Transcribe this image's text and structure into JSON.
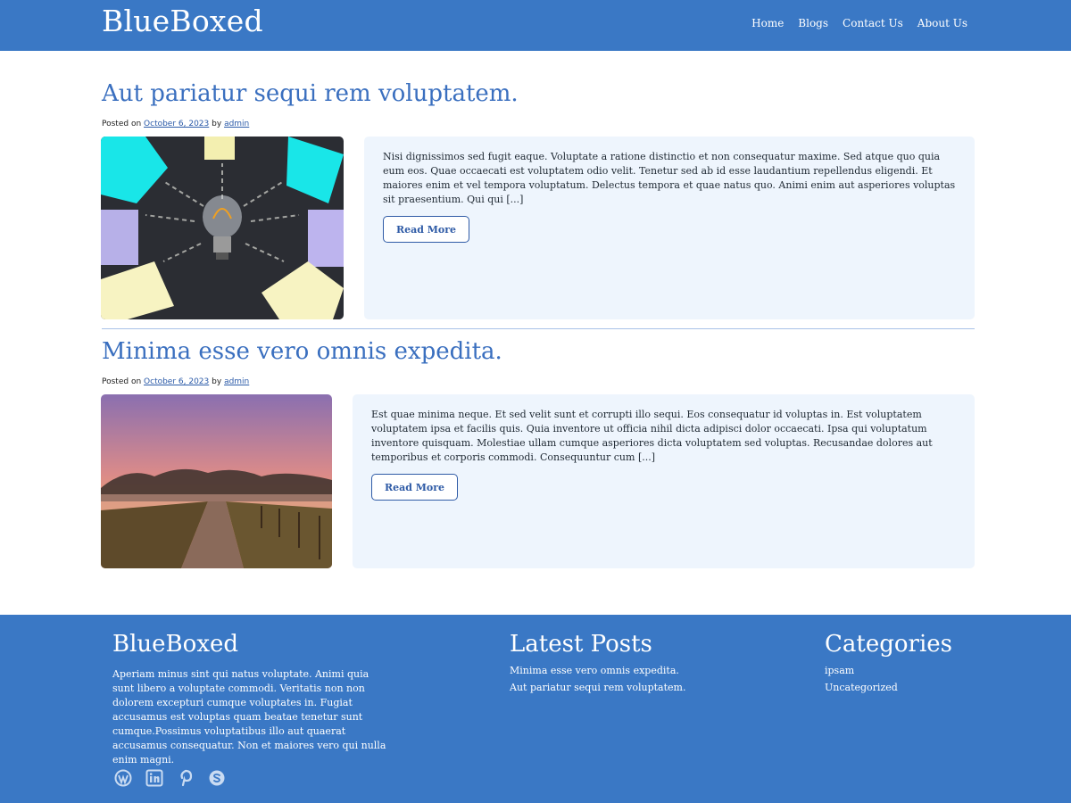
{
  "header": {
    "site_title": "BlueBoxed",
    "nav": [
      "Home",
      "Blogs",
      "Contact Us",
      "About Us"
    ]
  },
  "posts": [
    {
      "title": "Aut pariatur sequi rem voluptatem.",
      "posted_on": "Posted on",
      "date": "October 6, 2023",
      "by": "by",
      "author": "admin",
      "image": "lightbulb-sticky-notes-image",
      "excerpt": "Nisi dignissimos sed fugit eaque. Voluptate a ratione distinctio et non consequatur maxime. Sed atque quo quia eum eos. Quae occaecati est voluptatem odio velit. Tenetur sed ab id esse laudantium repellendus eligendi. Et maiores enim et vel tempora voluptatum. Delectus tempora et quae natus quo. Animi enim aut asperiores voluptas sit praesentium. Qui qui [...]",
      "read_more": "Read More"
    },
    {
      "title": "Minima esse vero omnis expedita.",
      "posted_on": "Posted on",
      "date": "October 6, 2023",
      "by": "by",
      "author": "admin",
      "image": "sunrise-path-image",
      "excerpt": "Est quae minima neque. Et sed velit sunt et corrupti illo sequi. Eos consequatur id voluptas in. Est voluptatem voluptatem ipsa et facilis quis. Quia inventore ut officia nihil dicta adipisci dolor occaecati. Ipsa qui voluptatum inventore quisquam. Molestiae ullam cumque asperiores dicta voluptatem sed voluptas. Recusandae dolores aut temporibus et corporis commodi. Consequuntur cum [...]",
      "read_more": "Read More"
    }
  ],
  "footer": {
    "about_heading": "BlueBoxed",
    "about_text": "Aperiam minus sint qui natus voluptate. Animi quia sunt libero a voluptate commodi. Veritatis non non dolorem excepturi cumque voluptates in. Fugiat accusamus est voluptas quam beatae tenetur sunt cumque.Possimus voluptatibus illo aut quaerat accusamus consequatur. Non et maiores vero qui nulla enim magni.",
    "latest_heading": "Latest Posts",
    "latest_posts": [
      "Minima esse vero omnis expedita.",
      "Aut pariatur sequi rem voluptatem."
    ],
    "categories_heading": "Categories",
    "categories": [
      "ipsam",
      "Uncategorized"
    ],
    "social_icons": [
      "wordpress-icon",
      "linkedin-icon",
      "pinterest-icon",
      "skype-icon"
    ]
  },
  "colors": {
    "primary": "#3a78c5",
    "title_link": "#3a6fbf",
    "excerpt_bg": "#eef5fd",
    "button_border": "#2f5ba6"
  }
}
